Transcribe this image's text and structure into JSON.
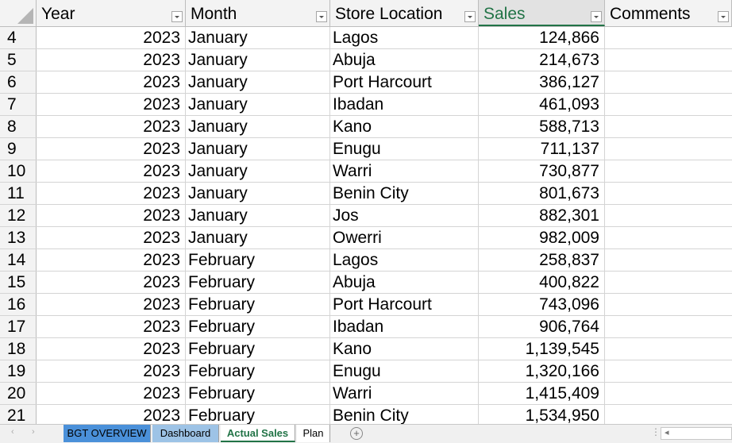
{
  "columns": {
    "year": "Year",
    "month": "Month",
    "store": "Store Location",
    "sales": "Sales",
    "comments": "Comments"
  },
  "rows": [
    {
      "num": "4",
      "year": "2023",
      "month": "January",
      "store": "Lagos",
      "sales": "124,866",
      "comments": ""
    },
    {
      "num": "5",
      "year": "2023",
      "month": "January",
      "store": "Abuja",
      "sales": "214,673",
      "comments": ""
    },
    {
      "num": "6",
      "year": "2023",
      "month": "January",
      "store": "Port Harcourt",
      "sales": "386,127",
      "comments": ""
    },
    {
      "num": "7",
      "year": "2023",
      "month": "January",
      "store": "Ibadan",
      "sales": "461,093",
      "comments": ""
    },
    {
      "num": "8",
      "year": "2023",
      "month": "January",
      "store": "Kano",
      "sales": "588,713",
      "comments": ""
    },
    {
      "num": "9",
      "year": "2023",
      "month": "January",
      "store": "Enugu",
      "sales": "711,137",
      "comments": ""
    },
    {
      "num": "10",
      "year": "2023",
      "month": "January",
      "store": "Warri",
      "sales": "730,877",
      "comments": ""
    },
    {
      "num": "11",
      "year": "2023",
      "month": "January",
      "store": "Benin City",
      "sales": "801,673",
      "comments": ""
    },
    {
      "num": "12",
      "year": "2023",
      "month": "January",
      "store": "Jos",
      "sales": "882,301",
      "comments": ""
    },
    {
      "num": "13",
      "year": "2023",
      "month": "January",
      "store": "Owerri",
      "sales": "982,009",
      "comments": ""
    },
    {
      "num": "14",
      "year": "2023",
      "month": "February",
      "store": "Lagos",
      "sales": "258,837",
      "comments": ""
    },
    {
      "num": "15",
      "year": "2023",
      "month": "February",
      "store": "Abuja",
      "sales": "400,822",
      "comments": ""
    },
    {
      "num": "16",
      "year": "2023",
      "month": "February",
      "store": "Port Harcourt",
      "sales": "743,096",
      "comments": ""
    },
    {
      "num": "17",
      "year": "2023",
      "month": "February",
      "store": "Ibadan",
      "sales": "906,764",
      "comments": ""
    },
    {
      "num": "18",
      "year": "2023",
      "month": "February",
      "store": "Kano",
      "sales": "1,139,545",
      "comments": ""
    },
    {
      "num": "19",
      "year": "2023",
      "month": "February",
      "store": "Enugu",
      "sales": "1,320,166",
      "comments": ""
    },
    {
      "num": "20",
      "year": "2023",
      "month": "February",
      "store": "Warri",
      "sales": "1,415,409",
      "comments": ""
    },
    {
      "num": "21",
      "year": "2023",
      "month": "February",
      "store": "Benin City",
      "sales": "1,534,950",
      "comments": ""
    }
  ],
  "sheet_tabs": {
    "bgt_overview": "BGT OVERVIEW",
    "dashboard": "Dashboard",
    "actual_sales": "Actual Sales",
    "plan": "Plan"
  },
  "icons": {
    "add_sheet": "plus-circle-icon",
    "filter": "filter-dropdown-icon"
  },
  "colors": {
    "accent_green": "#217346",
    "tab_bgt": "#4a90d9",
    "tab_dashboard": "#9dc3e6"
  }
}
